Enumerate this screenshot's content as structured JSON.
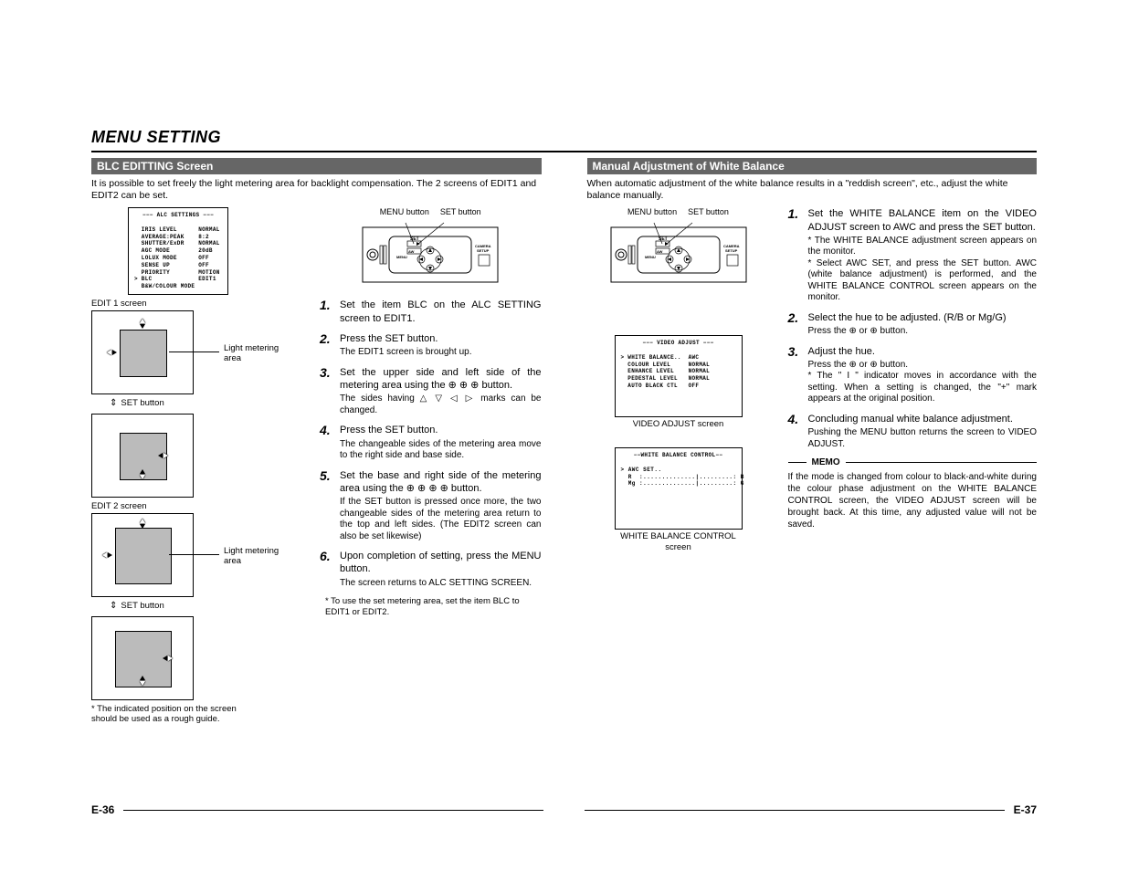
{
  "page_title": "MENU SETTING",
  "left": {
    "section": "BLC EDITTING Screen",
    "intro": "It is possible to set freely the light metering area for backlight compensation. The 2 screens of EDIT1 and EDIT2 can be set.",
    "alc_screen": {
      "title": "−−− ALC SETTINGS −−−",
      "rows": [
        [
          "IRIS LEVEL",
          "NORMAL"
        ],
        [
          "AVERAGE:PEAK",
          "8:2"
        ],
        [
          "SHUTTER/ExDR",
          "NORMAL"
        ],
        [
          "AGC MODE",
          "20dB"
        ],
        [
          "LOLUX MODE",
          "OFF"
        ],
        [
          "SENSE UP",
          "OFF"
        ],
        [
          "PRIORITY",
          "MOTION"
        ],
        [
          "BLC",
          "EDIT1"
        ],
        [
          "B&W/COLOUR MODE",
          ""
        ]
      ],
      "marker_row": 7
    },
    "panel": {
      "menu": "MENU button",
      "set": "SET button",
      "menu_lbl": "MENU",
      "set_lbl": "SET",
      "aw_lbl": "AW",
      "camera_setup": "CAMERA\nSETUP"
    },
    "edit1": "EDIT 1 screen",
    "edit2": "EDIT 2 screen",
    "light_metering": "Light metering area",
    "set_button_label": "SET button",
    "foot_note": "* The indicated position on the screen should be used as a rough guide.",
    "steps": [
      {
        "t": "Set the item BLC on the ALC SETTING screen to EDIT1."
      },
      {
        "t": "Press the SET button.",
        "s": "The EDIT1 screen is brought up."
      },
      {
        "t": "Set the upper side and left side of the metering area using the ⊕ ⊕ ⊕ button.",
        "s": "The sides having △ ▽ ◁ ▷ marks can be changed."
      },
      {
        "t": "Press the SET button.",
        "s": "The changeable sides of the metering area move to the right side and base side."
      },
      {
        "t": "Set the base and right side of the metering area using the ⊕ ⊕ ⊕ ⊕ button.",
        "s": "If the SET button is pressed once more, the two changeable sides of the metering area return to the top and left sides. (The EDIT2 screen can also be set likewise)"
      },
      {
        "t": "Upon completion of setting, press the MENU button.",
        "s": "The screen returns to ALC SETTING SCREEN."
      }
    ],
    "post_note": "* To use the set metering area, set the item BLC to EDIT1 or EDIT2.",
    "page_no": "E-36"
  },
  "right": {
    "section": "Manual Adjustment of White Balance",
    "intro": "When automatic adjustment of the white balance results in a \"reddish screen\", etc., adjust the white balance manually.",
    "panel": {
      "menu": "MENU button",
      "set": "SET button",
      "menu_lbl": "MENU",
      "set_lbl": "SET",
      "aw_lbl": "AW",
      "camera_setup": "CAMERA\nSETUP"
    },
    "video_adjust": {
      "title": "−−− VIDEO ADJUST −−−",
      "rows": [
        [
          "WHITE BALANCE..",
          "AWC"
        ],
        [
          "COLOUR LEVEL",
          "NORMAL"
        ],
        [
          "ENHANCE LEVEL",
          "NORMAL"
        ],
        [
          "PEDESTAL LEVEL",
          "NORMAL"
        ],
        [
          "AUTO BLACK CTL",
          "OFF"
        ]
      ],
      "marker_row": 0,
      "caption": "VIDEO ADJUST screen"
    },
    "wb_control": {
      "title": "−−WHITE BALANCE CONTROL−−",
      "rows": [
        "AWC SET..",
        "R  :..............|.........: B",
        "Mg :..............|.........: G"
      ],
      "caption": "WHITE BALANCE CONTROL screen"
    },
    "steps": [
      {
        "t": "Set the WHITE BALANCE item on the VIDEO ADJUST screen to AWC and press the SET button.",
        "s": "* The WHITE BALANCE adjustment screen appears on the monitor.\n* Select AWC SET, and press the SET button. AWC (white balance adjustment) is performed, and the WHITE BALANCE CONTROL screen appears on the monitor."
      },
      {
        "t": "Select the hue to be adjusted. (R/B or Mg/G)",
        "s": "Press the ⊕ or ⊕ button."
      },
      {
        "t": "Adjust the hue.",
        "s": "Press the ⊕ or ⊕ button.\n* The \" I \" indicator moves in accordance with the setting. When a setting is changed, the \"+\" mark appears at the original position."
      },
      {
        "t": "Concluding manual white balance adjustment.",
        "s": "Pushing the MENU button returns the screen to VIDEO ADJUST."
      }
    ],
    "memo_title": "MEMO",
    "memo": "If the mode is changed from colour to black-and-white during the colour phase adjustment on the WHITE BALANCE CONTROL screen, the VIDEO ADJUST screen will be brought back. At this time, any adjusted value will not be saved.",
    "page_no": "E-37"
  }
}
